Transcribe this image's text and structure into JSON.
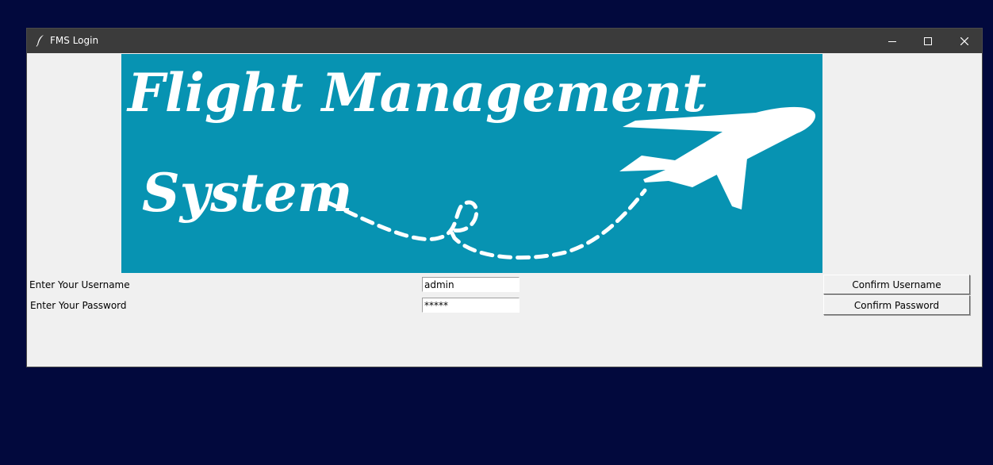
{
  "window": {
    "title": "FMS Login",
    "icon": "feather-icon",
    "controls": [
      "minimize-icon",
      "maximize-icon",
      "close-icon"
    ]
  },
  "banner": {
    "line1": "Flight Management",
    "line2": "System",
    "background": "#0793b2",
    "foreground": "#ffffff",
    "icon": "airplane-icon"
  },
  "form": {
    "username_label": "Enter Your Username",
    "password_label": "Enter Your Password",
    "username_value": "admin",
    "password_value": "*****",
    "confirm_username_label": "Confirm Username",
    "confirm_password_label": "Confirm Password"
  },
  "colors": {
    "desktop": "#02093d",
    "titlebar": "#3b3b3b",
    "window_bg": "#f0f0f0"
  }
}
